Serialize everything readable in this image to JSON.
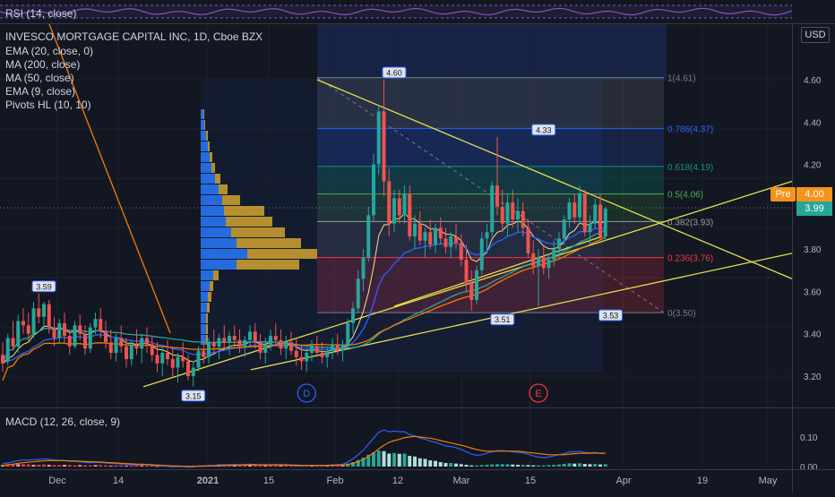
{
  "chart_data": {
    "type": "candlestick",
    "title": "INVESCO MORTGAGE CAPITAL INC, 1D, Cboe BZX",
    "currency": "USD",
    "ylim": [
      3.1,
      4.72
    ],
    "y_ticks": [
      "4.60",
      "4.40",
      "4.20",
      "4.00",
      "3.80",
      "3.60",
      "3.40",
      "3.20"
    ],
    "x_ticks": [
      "Dec",
      "14",
      "2021",
      "15",
      "Feb",
      "12",
      "Mar",
      "15",
      "Apr",
      "19",
      "May"
    ],
    "indicators": [
      "EMA (20, close, 0)",
      "MA (200, close)",
      "MA (50, close)",
      "EMA (9, close)",
      "Pivots HL (10, 10)"
    ],
    "rsi_label": "RSI (14, close)",
    "macd_label": "MACD (12, 26, close, 9)",
    "macd_ticks": [
      "0.10",
      "0.00"
    ],
    "pre_label": "Pre",
    "pre_price": "4.00",
    "last_price": "3.99",
    "fib_levels": [
      {
        "label": "1(4.61)",
        "price": 4.61
      },
      {
        "label": "0.786(4.37)",
        "price": 4.37
      },
      {
        "label": "0.618(4.19)",
        "price": 4.19
      },
      {
        "label": "0.5(4.06)",
        "price": 4.06
      },
      {
        "label": "0.382(3.93)",
        "price": 3.93
      },
      {
        "label": "0.236(3.76)",
        "price": 3.76
      },
      {
        "label": "0(3.50)",
        "price": 3.5
      }
    ],
    "pivots": [
      {
        "label": "3.59",
        "day": 8,
        "price": 3.59,
        "pos": "high"
      },
      {
        "label": "3.15",
        "day": 37,
        "price": 3.15,
        "pos": "low"
      },
      {
        "label": "4.60",
        "day": 76,
        "price": 4.6,
        "pos": "high"
      },
      {
        "label": "4.33",
        "day": 105,
        "price": 4.33,
        "pos": "high"
      },
      {
        "label": "3.51",
        "day": 97,
        "price": 3.51,
        "pos": "low"
      },
      {
        "label": "3.53",
        "day": 118,
        "price": 3.53,
        "pos": "low"
      }
    ],
    "events": [
      {
        "label": "D",
        "day": 59
      },
      {
        "label": "E",
        "day": 104
      }
    ],
    "candles": [
      {
        "o": 3.3,
        "h": 3.36,
        "l": 3.22,
        "c": 3.26
      },
      {
        "o": 3.27,
        "h": 3.4,
        "l": 3.25,
        "c": 3.38
      },
      {
        "o": 3.38,
        "h": 3.46,
        "l": 3.32,
        "c": 3.34
      },
      {
        "o": 3.34,
        "h": 3.49,
        "l": 3.31,
        "c": 3.46
      },
      {
        "o": 3.46,
        "h": 3.52,
        "l": 3.4,
        "c": 3.44
      },
      {
        "o": 3.44,
        "h": 3.5,
        "l": 3.36,
        "c": 3.4
      },
      {
        "o": 3.4,
        "h": 3.55,
        "l": 3.38,
        "c": 3.52
      },
      {
        "o": 3.52,
        "h": 3.59,
        "l": 3.45,
        "c": 3.48
      },
      {
        "o": 3.48,
        "h": 3.55,
        "l": 3.42,
        "c": 3.54
      },
      {
        "o": 3.54,
        "h": 3.56,
        "l": 3.4,
        "c": 3.43
      },
      {
        "o": 3.43,
        "h": 3.48,
        "l": 3.34,
        "c": 3.38
      },
      {
        "o": 3.38,
        "h": 3.47,
        "l": 3.35,
        "c": 3.45
      },
      {
        "o": 3.45,
        "h": 3.5,
        "l": 3.36,
        "c": 3.39
      },
      {
        "o": 3.39,
        "h": 3.42,
        "l": 3.3,
        "c": 3.34
      },
      {
        "o": 3.34,
        "h": 3.46,
        "l": 3.33,
        "c": 3.44
      },
      {
        "o": 3.44,
        "h": 3.49,
        "l": 3.37,
        "c": 3.4
      },
      {
        "o": 3.4,
        "h": 3.44,
        "l": 3.3,
        "c": 3.33
      },
      {
        "o": 3.33,
        "h": 3.45,
        "l": 3.31,
        "c": 3.43
      },
      {
        "o": 3.43,
        "h": 3.5,
        "l": 3.4,
        "c": 3.47
      },
      {
        "o": 3.47,
        "h": 3.52,
        "l": 3.38,
        "c": 3.41
      },
      {
        "o": 3.41,
        "h": 3.46,
        "l": 3.33,
        "c": 3.36
      },
      {
        "o": 3.36,
        "h": 3.42,
        "l": 3.28,
        "c": 3.31
      },
      {
        "o": 3.31,
        "h": 3.4,
        "l": 3.27,
        "c": 3.38
      },
      {
        "o": 3.38,
        "h": 3.44,
        "l": 3.31,
        "c": 3.34
      },
      {
        "o": 3.34,
        "h": 3.38,
        "l": 3.24,
        "c": 3.28
      },
      {
        "o": 3.28,
        "h": 3.37,
        "l": 3.25,
        "c": 3.35
      },
      {
        "o": 3.35,
        "h": 3.42,
        "l": 3.3,
        "c": 3.33
      },
      {
        "o": 3.33,
        "h": 3.4,
        "l": 3.26,
        "c": 3.38
      },
      {
        "o": 3.38,
        "h": 3.43,
        "l": 3.31,
        "c": 3.35
      },
      {
        "o": 3.35,
        "h": 3.39,
        "l": 3.27,
        "c": 3.3
      },
      {
        "o": 3.3,
        "h": 3.36,
        "l": 3.22,
        "c": 3.26
      },
      {
        "o": 3.26,
        "h": 3.34,
        "l": 3.2,
        "c": 3.31
      },
      {
        "o": 3.31,
        "h": 3.37,
        "l": 3.25,
        "c": 3.28
      },
      {
        "o": 3.28,
        "h": 3.34,
        "l": 3.2,
        "c": 3.24
      },
      {
        "o": 3.24,
        "h": 3.31,
        "l": 3.17,
        "c": 3.29
      },
      {
        "o": 3.29,
        "h": 3.36,
        "l": 3.24,
        "c": 3.27
      },
      {
        "o": 3.27,
        "h": 3.3,
        "l": 3.18,
        "c": 3.2
      },
      {
        "o": 3.2,
        "h": 3.27,
        "l": 3.15,
        "c": 3.24
      },
      {
        "o": 3.24,
        "h": 3.34,
        "l": 3.22,
        "c": 3.32
      },
      {
        "o": 3.32,
        "h": 3.37,
        "l": 3.26,
        "c": 3.29
      },
      {
        "o": 3.29,
        "h": 3.38,
        "l": 3.26,
        "c": 3.36
      },
      {
        "o": 3.36,
        "h": 3.42,
        "l": 3.31,
        "c": 3.34
      },
      {
        "o": 3.34,
        "h": 3.4,
        "l": 3.28,
        "c": 3.38
      },
      {
        "o": 3.38,
        "h": 3.44,
        "l": 3.33,
        "c": 3.36
      },
      {
        "o": 3.36,
        "h": 3.41,
        "l": 3.3,
        "c": 3.39
      },
      {
        "o": 3.39,
        "h": 3.44,
        "l": 3.34,
        "c": 3.37
      },
      {
        "o": 3.37,
        "h": 3.42,
        "l": 3.31,
        "c": 3.34
      },
      {
        "o": 3.34,
        "h": 3.39,
        "l": 3.29,
        "c": 3.37
      },
      {
        "o": 3.37,
        "h": 3.44,
        "l": 3.34,
        "c": 3.41
      },
      {
        "o": 3.41,
        "h": 3.45,
        "l": 3.33,
        "c": 3.36
      },
      {
        "o": 3.36,
        "h": 3.4,
        "l": 3.28,
        "c": 3.31
      },
      {
        "o": 3.31,
        "h": 3.38,
        "l": 3.26,
        "c": 3.35
      },
      {
        "o": 3.35,
        "h": 3.42,
        "l": 3.32,
        "c": 3.39
      },
      {
        "o": 3.39,
        "h": 3.45,
        "l": 3.34,
        "c": 3.37
      },
      {
        "o": 3.37,
        "h": 3.42,
        "l": 3.3,
        "c": 3.33
      },
      {
        "o": 3.33,
        "h": 3.39,
        "l": 3.28,
        "c": 3.36
      },
      {
        "o": 3.36,
        "h": 3.41,
        "l": 3.3,
        "c": 3.32
      },
      {
        "o": 3.32,
        "h": 3.38,
        "l": 3.25,
        "c": 3.29
      },
      {
        "o": 3.29,
        "h": 3.35,
        "l": 3.23,
        "c": 3.27
      },
      {
        "o": 3.27,
        "h": 3.33,
        "l": 3.22,
        "c": 3.31
      },
      {
        "o": 3.31,
        "h": 3.37,
        "l": 3.27,
        "c": 3.34
      },
      {
        "o": 3.34,
        "h": 3.39,
        "l": 3.29,
        "c": 3.31
      },
      {
        "o": 3.31,
        "h": 3.36,
        "l": 3.26,
        "c": 3.29
      },
      {
        "o": 3.29,
        "h": 3.34,
        "l": 3.24,
        "c": 3.32
      },
      {
        "o": 3.32,
        "h": 3.38,
        "l": 3.28,
        "c": 3.35
      },
      {
        "o": 3.35,
        "h": 3.4,
        "l": 3.3,
        "c": 3.32
      },
      {
        "o": 3.32,
        "h": 3.37,
        "l": 3.27,
        "c": 3.35
      },
      {
        "o": 3.35,
        "h": 3.47,
        "l": 3.33,
        "c": 3.45
      },
      {
        "o": 3.45,
        "h": 3.55,
        "l": 3.4,
        "c": 3.52
      },
      {
        "o": 3.52,
        "h": 3.7,
        "l": 3.5,
        "c": 3.66
      },
      {
        "o": 3.66,
        "h": 3.8,
        "l": 3.6,
        "c": 3.76
      },
      {
        "o": 3.76,
        "h": 4.0,
        "l": 3.74,
        "c": 3.96
      },
      {
        "o": 3.96,
        "h": 4.25,
        "l": 3.93,
        "c": 4.2
      },
      {
        "o": 4.2,
        "h": 4.48,
        "l": 4.15,
        "c": 4.45
      },
      {
        "o": 4.45,
        "h": 4.6,
        "l": 4.05,
        "c": 4.12
      },
      {
        "o": 4.12,
        "h": 4.18,
        "l": 3.86,
        "c": 3.92
      },
      {
        "o": 3.92,
        "h": 4.08,
        "l": 3.88,
        "c": 4.04
      },
      {
        "o": 4.04,
        "h": 4.08,
        "l": 3.92,
        "c": 3.96
      },
      {
        "o": 3.96,
        "h": 4.1,
        "l": 3.92,
        "c": 4.06
      },
      {
        "o": 4.06,
        "h": 4.1,
        "l": 3.84,
        "c": 3.86
      },
      {
        "o": 3.86,
        "h": 3.96,
        "l": 3.8,
        "c": 3.92
      },
      {
        "o": 3.92,
        "h": 3.98,
        "l": 3.82,
        "c": 3.84
      },
      {
        "o": 3.84,
        "h": 3.9,
        "l": 3.76,
        "c": 3.88
      },
      {
        "o": 3.88,
        "h": 3.94,
        "l": 3.8,
        "c": 3.82
      },
      {
        "o": 3.82,
        "h": 3.92,
        "l": 3.78,
        "c": 3.9
      },
      {
        "o": 3.9,
        "h": 3.95,
        "l": 3.82,
        "c": 3.85
      },
      {
        "o": 3.85,
        "h": 3.9,
        "l": 3.78,
        "c": 3.81
      },
      {
        "o": 3.81,
        "h": 3.88,
        "l": 3.76,
        "c": 3.86
      },
      {
        "o": 3.86,
        "h": 3.92,
        "l": 3.8,
        "c": 3.83
      },
      {
        "o": 3.83,
        "h": 3.87,
        "l": 3.72,
        "c": 3.75
      },
      {
        "o": 3.75,
        "h": 3.82,
        "l": 3.6,
        "c": 3.64
      },
      {
        "o": 3.64,
        "h": 3.7,
        "l": 3.51,
        "c": 3.56
      },
      {
        "o": 3.56,
        "h": 3.72,
        "l": 3.54,
        "c": 3.7
      },
      {
        "o": 3.7,
        "h": 3.88,
        "l": 3.68,
        "c": 3.85
      },
      {
        "o": 3.85,
        "h": 3.92,
        "l": 3.78,
        "c": 3.88
      },
      {
        "o": 3.88,
        "h": 4.12,
        "l": 3.86,
        "c": 4.1
      },
      {
        "o": 4.1,
        "h": 4.33,
        "l": 3.96,
        "c": 4.0
      },
      {
        "o": 4.0,
        "h": 4.08,
        "l": 3.88,
        "c": 3.92
      },
      {
        "o": 3.92,
        "h": 4.06,
        "l": 3.86,
        "c": 4.02
      },
      {
        "o": 4.02,
        "h": 4.08,
        "l": 3.9,
        "c": 3.94
      },
      {
        "o": 3.94,
        "h": 4.04,
        "l": 3.88,
        "c": 3.98
      },
      {
        "o": 3.98,
        "h": 4.02,
        "l": 3.86,
        "c": 3.9
      },
      {
        "o": 3.9,
        "h": 3.94,
        "l": 3.76,
        "c": 3.78
      },
      {
        "o": 3.78,
        "h": 3.84,
        "l": 3.68,
        "c": 3.72
      },
      {
        "o": 3.72,
        "h": 3.8,
        "l": 3.53,
        "c": 3.76
      },
      {
        "o": 3.76,
        "h": 3.82,
        "l": 3.68,
        "c": 3.71
      },
      {
        "o": 3.71,
        "h": 3.78,
        "l": 3.66,
        "c": 3.75
      },
      {
        "o": 3.75,
        "h": 3.84,
        "l": 3.72,
        "c": 3.8
      },
      {
        "o": 3.8,
        "h": 3.88,
        "l": 3.76,
        "c": 3.85
      },
      {
        "o": 3.85,
        "h": 3.96,
        "l": 3.82,
        "c": 3.94
      },
      {
        "o": 3.94,
        "h": 4.04,
        "l": 3.9,
        "c": 4.02
      },
      {
        "o": 4.02,
        "h": 4.06,
        "l": 3.92,
        "c": 3.95
      },
      {
        "o": 3.95,
        "h": 4.1,
        "l": 3.92,
        "c": 4.06
      },
      {
        "o": 4.06,
        "h": 4.08,
        "l": 3.86,
        "c": 3.88
      },
      {
        "o": 3.88,
        "h": 3.96,
        "l": 3.82,
        "c": 3.92
      },
      {
        "o": 3.92,
        "h": 4.04,
        "l": 3.9,
        "c": 4.01
      },
      {
        "o": 4.01,
        "h": 4.06,
        "l": 3.84,
        "c": 3.86
      },
      {
        "o": 3.86,
        "h": 4.0,
        "l": 3.84,
        "c": 3.99
      }
    ],
    "macd_hist": [
      0.005,
      0.006,
      0.007,
      0.008,
      0.008,
      0.007,
      0.006,
      0.006,
      0.007,
      0.006,
      0.005,
      0.005,
      0.006,
      0.005,
      0.004,
      0.005,
      0.004,
      0.004,
      0.005,
      0.005,
      0.004,
      0.003,
      0.004,
      0.004,
      0.003,
      0.003,
      0.004,
      0.004,
      0.003,
      0.003,
      0.002,
      0.003,
      0.003,
      0.002,
      0.003,
      0.003,
      0.002,
      0.003,
      0.004,
      0.004,
      0.004,
      0.004,
      0.005,
      0.005,
      0.004,
      0.005,
      0.004,
      0.004,
      0.005,
      0.005,
      0.004,
      0.004,
      0.004,
      0.005,
      0.004,
      0.004,
      0.003,
      0.003,
      0.004,
      0.004,
      0.005,
      0.004,
      0.004,
      0.005,
      0.005,
      0.004,
      0.005,
      0.01,
      0.015,
      0.022,
      0.03,
      0.04,
      0.048,
      0.054,
      0.052,
      0.044,
      0.046,
      0.043,
      0.044,
      0.036,
      0.034,
      0.028,
      0.026,
      0.021,
      0.019,
      0.015,
      0.012,
      0.012,
      0.01,
      0.008,
      0.006,
      0.004,
      0.004,
      0.005,
      0.006,
      0.007,
      0.008,
      0.008,
      0.008,
      0.007,
      0.006,
      0.006,
      0.005,
      0.004,
      0.004,
      0.004,
      0.005,
      0.006,
      0.007,
      0.009,
      0.011,
      0.01,
      0.011,
      0.009,
      0.008,
      0.009,
      0.007,
      0.008
    ],
    "macd_line": [
      0.01,
      0.012,
      0.016,
      0.02,
      0.022,
      0.022,
      0.023,
      0.024,
      0.026,
      0.025,
      0.022,
      0.021,
      0.02,
      0.018,
      0.017,
      0.016,
      0.014,
      0.013,
      0.014,
      0.014,
      0.012,
      0.01,
      0.01,
      0.009,
      0.007,
      0.006,
      0.006,
      0.007,
      0.006,
      0.004,
      0.002,
      0.002,
      0.001,
      -0.001,
      0.0,
      0.0,
      -0.002,
      -0.001,
      0.002,
      0.002,
      0.004,
      0.004,
      0.006,
      0.006,
      0.007,
      0.007,
      0.006,
      0.007,
      0.008,
      0.007,
      0.005,
      0.005,
      0.006,
      0.006,
      0.005,
      0.005,
      0.004,
      0.002,
      0.002,
      0.003,
      0.004,
      0.003,
      0.003,
      0.004,
      0.006,
      0.006,
      0.008,
      0.016,
      0.026,
      0.04,
      0.056,
      0.076,
      0.096,
      0.116,
      0.124,
      0.118,
      0.12,
      0.118,
      0.118,
      0.108,
      0.104,
      0.096,
      0.092,
      0.086,
      0.082,
      0.076,
      0.07,
      0.068,
      0.064,
      0.058,
      0.05,
      0.042,
      0.038,
      0.04,
      0.046,
      0.05,
      0.054,
      0.054,
      0.052,
      0.05,
      0.048,
      0.046,
      0.042,
      0.036,
      0.032,
      0.03,
      0.032,
      0.036,
      0.04,
      0.044,
      0.05,
      0.05,
      0.052,
      0.048,
      0.046,
      0.048,
      0.044,
      0.046
    ],
    "signal_line": [
      0.004,
      0.006,
      0.008,
      0.011,
      0.013,
      0.015,
      0.016,
      0.018,
      0.019,
      0.02,
      0.02,
      0.02,
      0.02,
      0.019,
      0.019,
      0.018,
      0.017,
      0.016,
      0.016,
      0.015,
      0.014,
      0.013,
      0.012,
      0.011,
      0.01,
      0.009,
      0.008,
      0.008,
      0.007,
      0.006,
      0.005,
      0.004,
      0.003,
      0.002,
      0.002,
      0.001,
      0.001,
      0.0,
      0.001,
      0.001,
      0.002,
      0.002,
      0.003,
      0.004,
      0.004,
      0.005,
      0.005,
      0.005,
      0.006,
      0.006,
      0.006,
      0.006,
      0.006,
      0.006,
      0.006,
      0.006,
      0.005,
      0.005,
      0.004,
      0.004,
      0.004,
      0.004,
      0.004,
      0.004,
      0.004,
      0.005,
      0.005,
      0.007,
      0.011,
      0.017,
      0.024,
      0.034,
      0.046,
      0.06,
      0.072,
      0.082,
      0.088,
      0.092,
      0.098,
      0.1,
      0.102,
      0.1,
      0.098,
      0.096,
      0.092,
      0.088,
      0.084,
      0.08,
      0.076,
      0.072,
      0.068,
      0.062,
      0.058,
      0.054,
      0.052,
      0.052,
      0.052,
      0.052,
      0.052,
      0.052,
      0.052,
      0.05,
      0.048,
      0.046,
      0.044,
      0.042,
      0.04,
      0.04,
      0.04,
      0.04,
      0.042,
      0.044,
      0.045,
      0.045,
      0.045,
      0.046,
      0.045,
      0.045
    ]
  }
}
